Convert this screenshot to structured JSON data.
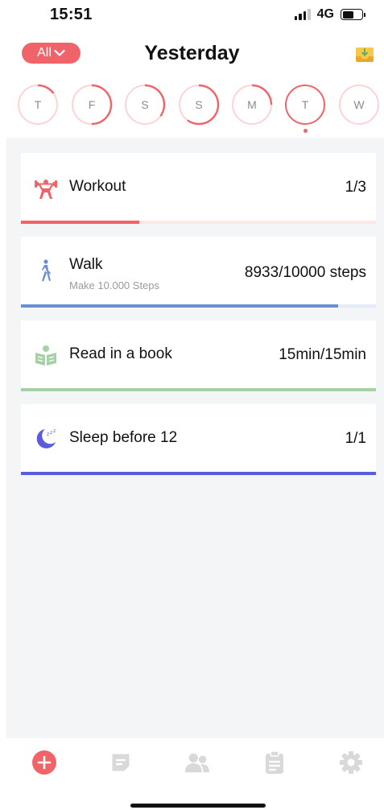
{
  "status_bar": {
    "time": "15:51",
    "network": "4G",
    "battery_level": 0.6
  },
  "header": {
    "filter_label": "All",
    "title": "Yesterday",
    "inbox_icon": "inbox-download-icon"
  },
  "days": [
    {
      "label": "T",
      "progress": 0.15,
      "selected": false
    },
    {
      "label": "F",
      "progress": 0.5,
      "selected": false
    },
    {
      "label": "S",
      "progress": 0.35,
      "selected": false
    },
    {
      "label": "S",
      "progress": 0.6,
      "selected": false
    },
    {
      "label": "M",
      "progress": 0.25,
      "selected": false
    },
    {
      "label": "T",
      "progress": 0.85,
      "selected": true
    },
    {
      "label": "W",
      "progress": 0.0,
      "selected": false
    }
  ],
  "habits": [
    {
      "name": "Workout",
      "subtitle": "",
      "progress_text": "1/3",
      "progress": 0.333,
      "icon": "weightlifter-icon",
      "color": "#f06469",
      "track_color": "#fde8e9"
    },
    {
      "name": "Walk",
      "subtitle": "Make 10.000 Steps",
      "progress_text": "8933/10000 steps",
      "progress": 0.893,
      "icon": "walking-person-icon",
      "color": "#6b8fd0",
      "track_color": "#e6ecf7"
    },
    {
      "name": "Read in a book",
      "subtitle": "",
      "progress_text": "15min/15min",
      "progress": 1.0,
      "icon": "reading-book-icon",
      "color": "#a8d0a6",
      "track_color": "#e8f3e7"
    },
    {
      "name": "Sleep before 12",
      "subtitle": "",
      "progress_text": "1/1",
      "progress": 1.0,
      "icon": "moon-sleep-icon",
      "color": "#5b5bdc",
      "track_color": "#e4e4f8"
    }
  ],
  "tab_bar": [
    {
      "name": "add-tab",
      "icon": "plus-icon",
      "active": true
    },
    {
      "name": "notes-tab",
      "icon": "note-icon",
      "active": false
    },
    {
      "name": "friends-tab",
      "icon": "people-icon",
      "active": false
    },
    {
      "name": "clipboard-tab",
      "icon": "clipboard-icon",
      "active": false
    },
    {
      "name": "settings-tab",
      "icon": "gear-icon",
      "active": false
    }
  ],
  "colors": {
    "accent": "#f06469",
    "background": "#f4f5f7",
    "inactive_icon": "#d9d9d9"
  }
}
